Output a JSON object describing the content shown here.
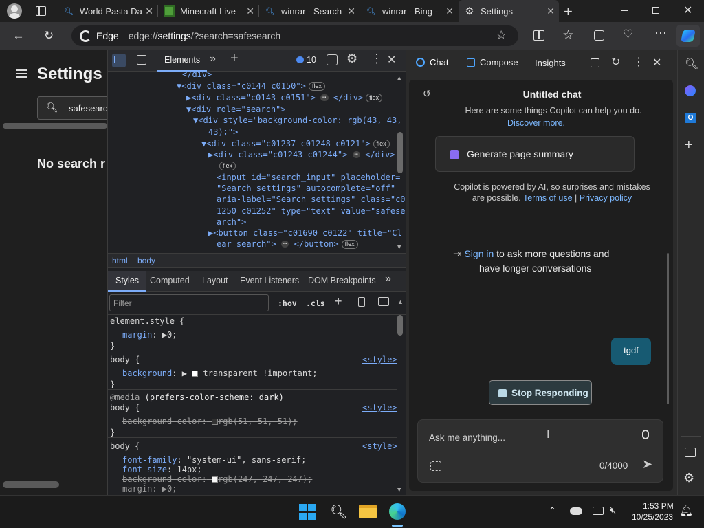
{
  "tabs": [
    {
      "title": "World Pasta Da",
      "icon": "bing-search-icon"
    },
    {
      "title": "Minecraft Live",
      "icon": "minecraft-icon"
    },
    {
      "title": "winrar - Search",
      "icon": "bing-search-icon"
    },
    {
      "title": "winrar - Bing -",
      "icon": "bing-search-icon"
    },
    {
      "title": "Settings",
      "icon": "gear-icon",
      "active": true
    }
  ],
  "address": {
    "chip_label": "Edge",
    "url_prefix": "edge://",
    "url_host": "settings",
    "url_rest": "/?search=safesearch"
  },
  "settings_page": {
    "title": "Settings",
    "search_value": "safesearch",
    "no_results": "No search r"
  },
  "devtools": {
    "tabs": [
      "Elements"
    ],
    "issues_count": "10",
    "dom_lines": [
      {
        "indent": 0,
        "html": "</div>"
      },
      {
        "indent": 1,
        "html": "▼<div class=\"c0144 c0150\">",
        "flex": true
      },
      {
        "indent": 2,
        "html": "▶<div class=\"c0143 c0151\">",
        "ellipsis": true,
        "tail": "</div>",
        "flex": true
      },
      {
        "indent": 2,
        "html": "▼<div role=\"search\">"
      },
      {
        "indent": 3,
        "html": "▼<div style=\"background-color: rgb(43, 43,"
      },
      {
        "indent": 4,
        "html": "43);\">"
      },
      {
        "indent": 4,
        "html": "▼<div class=\"c01237 c01248 c0121\">",
        "flex": true
      },
      {
        "indent": 5,
        "html": "▶<div class=\"c01243 c01244\">",
        "ellipsis": true,
        "tail": "</div>"
      },
      {
        "indent": 6,
        "html": "",
        "flex": true
      },
      {
        "indent": 6,
        "html": "<input id=\"search_input\" placeholder="
      },
      {
        "indent": 6,
        "html": "\"Search settings\" autocomplete=\"off\""
      },
      {
        "indent": 6,
        "html": "aria-label=\"Search settings\" class=\"c0"
      },
      {
        "indent": 6,
        "html": "1250 c01252\" type=\"text\" value=\"safese"
      },
      {
        "indent": 6,
        "html": "arch\">"
      },
      {
        "indent": 5,
        "html": "▶<button class=\"c01690 c0122\" title=\"Cl"
      },
      {
        "indent": 6,
        "html": "ear search\">",
        "ellipsis": true,
        "tail": "</button>",
        "flex": true
      }
    ],
    "breadcrumbs": [
      "html",
      "body"
    ],
    "subtabs": [
      "Styles",
      "Computed",
      "Layout",
      "Event Listeners",
      "DOM Breakpoints"
    ],
    "filter_placeholder": "Filter",
    "hov": ":hov",
    "cls": ".cls",
    "styles": {
      "element_style": "element.style {",
      "margin_prop": "margin",
      "margin_val": "0;",
      "body_sel": "body {",
      "background_prop": "background",
      "background_val": "transparent !important;",
      "media": "@media",
      "media_query": "(prefers-color-scheme: dark)",
      "bg_color_prop": "background-color:",
      "bg_color_val1": "rgb(51, 51, 51);",
      "font_family_prop": "font-family",
      "font_family_val": "\"system-ui\", sans-serif;",
      "font_size_prop": "font-size",
      "font_size_val": "14px;",
      "bg_color_val2": "rgb(247, 247, 247);",
      "margin2": "margin: ▶0;",
      "source": "<style>",
      "close": "}"
    }
  },
  "copilot": {
    "tabs": [
      "Chat",
      "Compose",
      "Insights"
    ],
    "chat_title": "Untitled chat",
    "intro": "Here are some things Copilot can help you do.",
    "discover": "Discover more.",
    "summary_button": "Generate page summary",
    "disclaimer_1": "Copilot is powered by AI, so surprises and mistakes",
    "disclaimer_2": "are possible.",
    "terms": "Terms of use",
    "privacy": "Privacy policy",
    "signin_link": "Sign in",
    "signin_rest": "to ask more questions and",
    "signin_line2": "have longer conversations",
    "user_message": "tgdf",
    "stop_button": "Stop Responding",
    "input_placeholder": "Ask me anything...",
    "char_count": "0/4000"
  },
  "taskbar": {
    "time": "1:53 PM",
    "date": "10/25/2023"
  }
}
